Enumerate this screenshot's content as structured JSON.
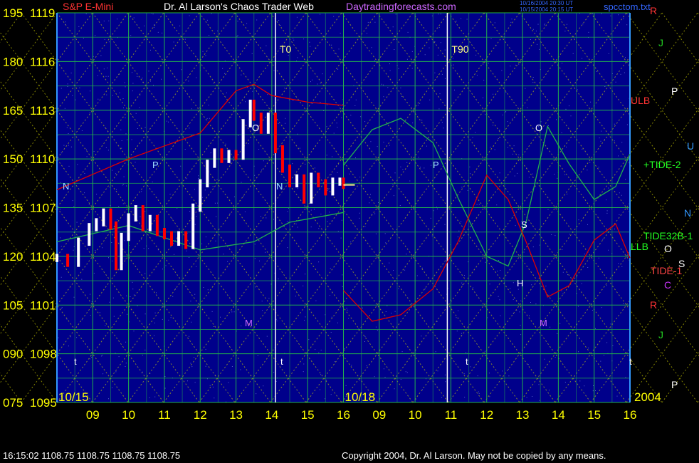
{
  "header": {
    "instrument": "S&P E-Mini",
    "site_title": "Dr. Al Larson's Chaos Trader Web",
    "site_url": "Daytradingforecasts.com",
    "stamp_line1": "10/16/2004 20:30 UT",
    "stamp_line2": "10/15/2004 20:15 UT",
    "file_name": "spcctom.txt"
  },
  "footer": {
    "quote": "16:15:02  1108.75 1108.75 1108.75 1108.75",
    "copyright": "Copyright 2004, Dr. Al Larson. May not be copied by any means."
  },
  "colors": {
    "background": "#000000",
    "plot_bg": "#00008b",
    "grid": "#22b14c",
    "axis_text": "#ffff00",
    "date_text": "#ffff00",
    "price_up": "#ffffff",
    "price_down": "#ff0000",
    "tide_green": "#22b14c",
    "red_curve": "#dd0000"
  },
  "chart_data": {
    "type": "line",
    "title": "Dr. Al Larson's Chaos Trader Web",
    "y_left_labels": [
      "195",
      "180",
      "165",
      "150",
      "135",
      "120",
      "105",
      "090",
      "075"
    ],
    "y_price_labels": [
      "1119",
      "1116",
      "1113",
      "1110",
      "1107",
      "1104",
      "1101",
      "1098",
      "1095"
    ],
    "ylim": [
      1095,
      1119
    ],
    "date_labels": [
      {
        "text": "10/15",
        "hour": 8.0
      },
      {
        "text": "10/18",
        "hour": 16.0
      },
      {
        "text": "2004",
        "hour": 24.0
      }
    ],
    "hour_ticks": [
      "09",
      "10",
      "11",
      "12",
      "13",
      "14",
      "15",
      "16",
      "09",
      "10",
      "11",
      "12",
      "13",
      "14",
      "15",
      "16"
    ],
    "x_range_hours": [
      8.0,
      24.0
    ],
    "time_markers": [
      {
        "label": "T0",
        "hour": 14.1
      },
      {
        "label": "T90",
        "hour": 18.9
      }
    ],
    "right_labels": [
      "R",
      "J",
      "P",
      "U",
      "N",
      "O",
      "S",
      "C",
      "R",
      "J",
      "P"
    ],
    "line_labels": [
      "ULB",
      "+TIDE-2",
      "TIDE32B-1",
      "LLB",
      "TIDE-1"
    ],
    "plot_letters": [
      "N",
      "P",
      "N",
      "P",
      "O",
      "O",
      "M",
      "M",
      "S",
      "H",
      "t",
      "t",
      "t",
      "t"
    ],
    "series": [
      {
        "name": "S&P E-Mini",
        "x_hours": [
          8.0,
          8.3,
          8.6,
          8.9,
          9.1,
          9.3,
          9.5,
          9.65,
          9.8,
          10.0,
          10.2,
          10.4,
          10.6,
          10.8,
          11.0,
          11.2,
          11.4,
          11.6,
          11.8,
          12.0,
          12.2,
          12.4,
          12.6,
          12.8,
          13.0,
          13.2,
          13.4,
          13.5,
          13.7,
          13.9,
          14.1,
          14.3,
          14.5,
          14.7,
          14.9,
          15.1,
          15.3,
          15.5,
          15.7,
          15.9,
          16.0
        ],
        "values": [
          1103.9,
          1103.6,
          1104.9,
          1105.8,
          1106.1,
          1106.7,
          1105.9,
          1103.4,
          1105.2,
          1106.4,
          1106.9,
          1105.8,
          1106.3,
          1105.5,
          1105.3,
          1104.9,
          1105.3,
          1104.7,
          1107.0,
          1108.5,
          1109.7,
          1110.4,
          1110.0,
          1110.3,
          1110.2,
          1112.2,
          1113.4,
          1112.6,
          1111.8,
          1112.6,
          1110.6,
          1109.4,
          1108.5,
          1108.8,
          1107.5,
          1108.9,
          1108.5,
          1108.0,
          1108.6,
          1108.6,
          1108.4
        ]
      },
      {
        "name": "ULB",
        "x_hours": [
          8.0,
          10.0,
          12.0,
          13.0,
          13.5,
          14.0,
          15.0,
          16.0
        ],
        "values": [
          1108.1,
          1110.0,
          1111.6,
          1114.2,
          1114.6,
          1113.9,
          1113.5,
          1113.3
        ]
      },
      {
        "name": "LLB",
        "x_hours": [
          8.0,
          10.0,
          12.0,
          13.5,
          14.5,
          16.0
        ],
        "values": [
          1104.9,
          1105.9,
          1104.4,
          1104.9,
          1106.1,
          1106.7
        ]
      },
      {
        "name": "+TIDE-2",
        "x_hours": [
          16.0,
          16.8,
          17.6,
          18.5,
          19.2,
          20.0,
          20.6,
          21.1,
          21.7,
          22.3,
          23.0,
          23.6,
          24.0
        ],
        "values": [
          1109.6,
          1111.8,
          1112.5,
          1111.0,
          1107.6,
          1104.0,
          1103.4,
          1106.1,
          1112.0,
          1109.7,
          1107.5,
          1108.3,
          1110.3
        ]
      },
      {
        "name": "TIDE-1",
        "x_hours": [
          16.0,
          16.8,
          17.6,
          18.5,
          19.2,
          20.0,
          20.6,
          21.1,
          21.7,
          22.3,
          23.0,
          23.6,
          24.0
        ],
        "values": [
          1101.9,
          1100.0,
          1100.4,
          1102.0,
          1104.9,
          1109.0,
          1107.5,
          1104.9,
          1101.5,
          1102.2,
          1105.0,
          1106.0,
          1103.9
        ]
      }
    ]
  }
}
